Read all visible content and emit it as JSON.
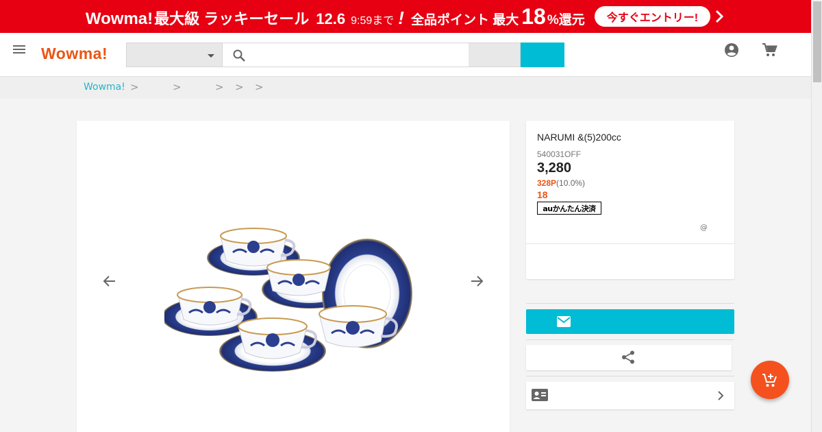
{
  "banner": {
    "brand": "Wowma!",
    "sale": "最大級 ラッキーセール",
    "date": "12.6",
    "time": "9:59まで",
    "excl": "!",
    "points_label": "全品ポイント 最大",
    "points_num": "18",
    "points_suffix": "%還元",
    "cta": "今すぐエントリー!",
    "color": "#e60012"
  },
  "header": {
    "logo": "Wowma!",
    "search": {
      "category_value": "",
      "placeholder": "",
      "scope_value": "",
      "button_label": ""
    },
    "icons": [
      "menu-icon",
      "search-icon",
      "account-icon",
      "cart-icon"
    ],
    "accent": "#00bcd4"
  },
  "breadcrumb": {
    "home": "Wowma!",
    "separator": ">"
  },
  "product": {
    "title": "NARUMI  &(5)200cc",
    "code": "540031OFF",
    "price": "3,280",
    "points": "328P",
    "points_rate": "(10.0%)",
    "bonus": "18",
    "payment_badge": "auかんたん決済",
    "at_mark": "@"
  },
  "actions": {
    "mail_icon": "mail-icon",
    "share_icon": "share-icon",
    "contact_icon": "contact-card-icon",
    "fab_icon": "add-to-cart-icon",
    "fab_color": "#f4511e"
  }
}
